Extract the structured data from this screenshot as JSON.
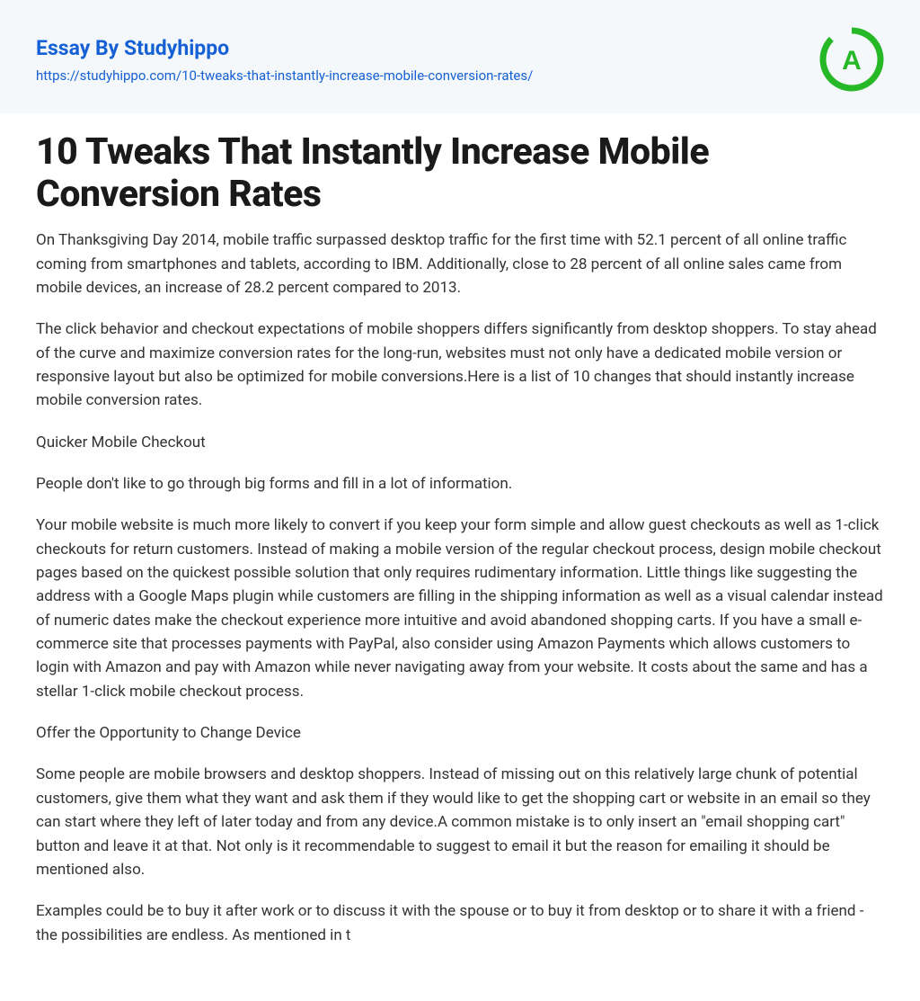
{
  "header": {
    "title": "Essay By Studyhippo",
    "url": "https://studyhippo.com/10-tweaks-that-instantly-increase-mobile-conversion-rates/",
    "logo_letter": "A"
  },
  "article": {
    "title": "10 Tweaks That Instantly Increase Mobile Conversion Rates",
    "paragraphs": [
      "On Thanksgiving Day 2014, mobile traffic surpassed desktop traffic for the first time with 52.1 percent of all online traffic coming from smartphones and tablets, according to IBM. Additionally, close to 28 percent of all online sales came from mobile devices, an increase of 28.2 percent compared to 2013.",
      "The click behavior and checkout expectations of mobile shoppers differs significantly from desktop shoppers. To stay ahead of the curve and maximize conversion rates for the long-run, websites must not only have a dedicated mobile version or responsive layout but also be optimized for mobile conversions.Here is a list of 10 changes that should instantly increase mobile conversion rates.",
      "Quicker  Mobile Checkout",
      "People don't like to go through big forms and fill in a lot of information.",
      "Your mobile website is much more likely to convert if you keep your form simple and allow guest checkouts as well as 1-click checkouts for return customers. Instead of making a mobile version of the regular checkout process, design mobile checkout pages based on the quickest possible solution that only requires rudimentary information. Little things like suggesting the address with a Google Maps plugin while customers are filling in the shipping information as well as a visual calendar instead of numeric dates make the checkout experience more intuitive and avoid abandoned shopping carts. If you have a small e-commerce site that processes payments with PayPal, also consider using Amazon Payments which allows customers to login with Amazon and pay with Amazon while never navigating away from your website. It costs about the same and has a stellar 1-click mobile checkout process.",
      "Offer the Opportunity to Change Device",
      "Some people are mobile browsers and desktop shoppers. Instead of missing out on this relatively large chunk of potential customers, give them what they want and ask them if they would like to get the shopping cart or website in an email so they can start where they left of later today and from any device.A common mistake is to only insert an \"email shopping cart\" button and leave it at that. Not only is it recommendable to suggest to email it but the reason  for emailing it should be mentioned also.",
      "Examples could be to buy it after work or to discuss it with the spouse or to buy it from desktop or to share it with a friend - the possibilities are endless. As mentioned in t"
    ]
  }
}
